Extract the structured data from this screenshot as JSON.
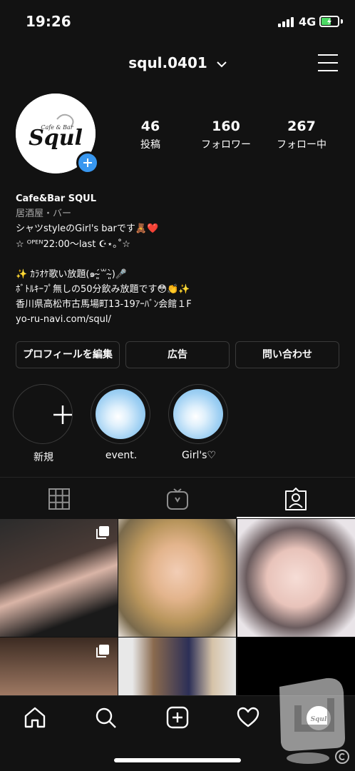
{
  "status": {
    "time": "19:26",
    "network": "4G"
  },
  "header": {
    "username": "squl.0401",
    "dropdown_icon": "chevron-down-icon",
    "menu_icon": "hamburger-menu-icon"
  },
  "profile": {
    "avatar_logo_text": "Squl",
    "avatar_logo_subtext": "Cafe & Bar",
    "stats": [
      {
        "value": "46",
        "label": "投稿"
      },
      {
        "value": "160",
        "label": "フォロワー"
      },
      {
        "value": "267",
        "label": "フォロー中"
      }
    ]
  },
  "bio": {
    "name": "Cafe&Bar SQUL",
    "category": "居酒屋・バー",
    "lines": [
      "シャツstyleのGirl's barです🧸❤️",
      "☆ ᴼᴾᴱᴺ22:00〜last ☪︎⋆｡˚☆",
      "✨ ｶﾗｵｹ歌い放題(๑ˊ̴͈꒳ˋ̴͈)🎤",
      "ﾎﾞﾄﾙｷｰﾌﾟ無しの50分飲み放題です😳👏✨",
      "香川県高松市古馬場町13-19ｱｰﾊﾞﾝ会館１F"
    ],
    "link": "yo-ru-navi.com/squl/"
  },
  "buttons": {
    "edit_profile": "プロフィールを編集",
    "ads": "広告",
    "contact": "問い合わせ"
  },
  "highlights": [
    {
      "label": "新規",
      "type": "new"
    },
    {
      "label": "event.",
      "type": "story"
    },
    {
      "label": "Girl's♡",
      "type": "story"
    }
  ],
  "tabs": [
    {
      "icon": "grid-icon",
      "active": false
    },
    {
      "icon": "igtv-icon",
      "active": false
    },
    {
      "icon": "tagged-icon",
      "active": true
    }
  ],
  "bottom_nav": [
    {
      "icon": "home-icon"
    },
    {
      "icon": "search-icon"
    },
    {
      "icon": "new-post-icon"
    },
    {
      "icon": "heart-icon"
    },
    {
      "icon": "profile-avatar-icon"
    }
  ],
  "colors": {
    "background": "#121212",
    "accent": "#3897f0",
    "border": "#3a3a3a"
  }
}
